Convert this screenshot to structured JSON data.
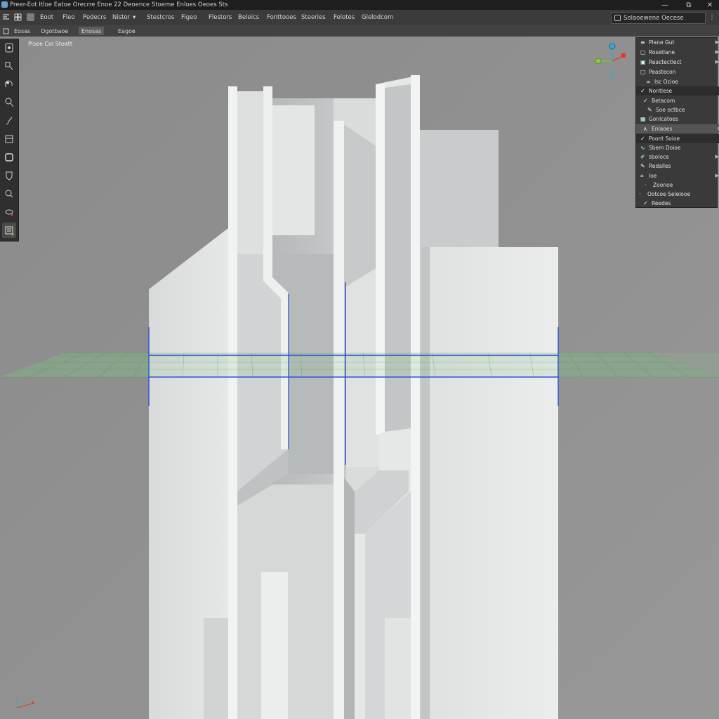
{
  "app": {
    "title": "Preer-Eot  Itloe  Eatoe  Orecrre  Enoe  22  Deoence  Stoeme  Enloes  Oeoes Sts"
  },
  "window_controls": {
    "minimize": "—",
    "maximize": "⧉",
    "close": "✕"
  },
  "menu": {
    "items": [
      "Eoot",
      "Fleo",
      "Pedecrs",
      "Nistor",
      "▾",
      "Stestcros",
      "Figeo",
      "Flestors",
      "Beleics",
      "Fonttooes",
      "Steeries",
      "Felotes",
      "Glelodcom"
    ]
  },
  "search": {
    "value": "Solaoewene  Oecese"
  },
  "subbar": {
    "tabs": [
      "Eosas",
      "Ogotbaoe",
      "Enosas",
      "Eagoe"
    ],
    "active_index": 2
  },
  "viewport": {
    "label": "Pisee Col  Stoatt"
  },
  "toolbar": {
    "tools": [
      "select-tool",
      "move-tool",
      "rotate-tool",
      "scale-tool",
      "brush-tool",
      "frame-tool",
      "box-tool",
      "shield-tool",
      "zoom-tool",
      "orbit-tool",
      "layers-tool"
    ],
    "active_index": 10
  },
  "panel": {
    "rows": [
      {
        "label": "Plane Gut",
        "icon": "list-icon",
        "indent": 0,
        "arrow": true,
        "style": "normal"
      },
      {
        "label": "Rosetlane",
        "icon": "cube-icon",
        "indent": 0,
        "arrow": true,
        "style": "normal"
      },
      {
        "label": "Reactectlect",
        "icon": "image-icon",
        "indent": 0,
        "arrow": true,
        "style": "normal"
      },
      {
        "label": "Peastecon",
        "icon": "square-icon",
        "indent": 0,
        "arrow": false,
        "style": "normal"
      },
      {
        "label": "Isc Ocioe",
        "icon": "link-icon",
        "indent": 1,
        "arrow": false,
        "style": "normal"
      },
      {
        "label": "Nontlese",
        "icon": "check-icon",
        "indent": 0,
        "arrow": false,
        "style": "hl2"
      },
      {
        "label": "Betacom",
        "icon": "check-icon",
        "indent": 1,
        "arrow": false,
        "style": "normal"
      },
      {
        "label": "Soe octbce",
        "icon": "wrench-icon",
        "indent": 2,
        "arrow": false,
        "style": "normal"
      },
      {
        "label": "Gonlcatoes",
        "icon": "grid-icon",
        "indent": 0,
        "arrow": false,
        "style": "normal"
      },
      {
        "label": "Enlaoes",
        "icon": "pen-icon",
        "indent": 1,
        "arrow": true,
        "style": "hl"
      },
      {
        "label": "Poont Soioe",
        "icon": "check-icon",
        "indent": 0,
        "arrow": false,
        "style": "hl2"
      },
      {
        "label": "Sbem Doioe",
        "icon": "wave-icon",
        "indent": 0,
        "arrow": false,
        "style": "normal"
      },
      {
        "label": "sboIoce",
        "icon": "pin-icon",
        "indent": 0,
        "arrow": true,
        "style": "normal"
      },
      {
        "label": "Redalles",
        "icon": "pen-icon",
        "indent": 0,
        "arrow": false,
        "style": "normal"
      },
      {
        "label": "Ioe",
        "icon": "tag-icon",
        "indent": 0,
        "arrow": true,
        "style": "normal"
      },
      {
        "label": "Zoonoe",
        "icon": "dot-icon",
        "indent": 1,
        "arrow": false,
        "style": "normal"
      },
      {
        "label": "Ootcoe Selelooe",
        "icon": "dot-icon",
        "indent": 0,
        "arrow": false,
        "style": "normal"
      },
      {
        "label": "Reedes",
        "icon": "check-icon",
        "indent": 1,
        "arrow": false,
        "style": "normal"
      }
    ]
  },
  "colors": {
    "accent_blue": "#2b54d8",
    "grid_green": "#3f9a45",
    "axis_x": "#e03a2c",
    "axis_y": "#7ac23a",
    "axis_z": "#3aa7d0"
  }
}
